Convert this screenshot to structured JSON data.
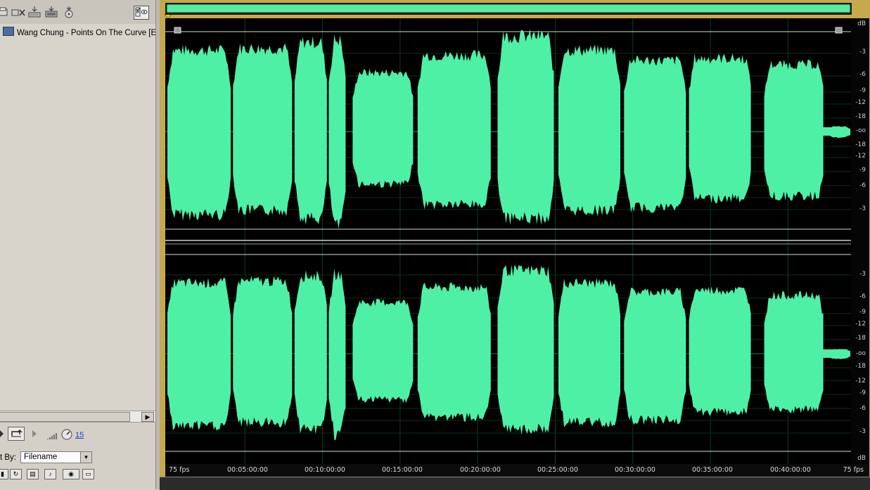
{
  "file_browser": {
    "files": [
      {
        "name": "Wang Chung - Points On The Curve [EU]."
      }
    ],
    "transport": {
      "volume_value": "15"
    },
    "sort": {
      "label": "t By:",
      "selected": "Filename"
    }
  },
  "editor": {
    "colors": {
      "waveform": "#4ef0a6",
      "background": "#000000",
      "frame": "#c7a94d"
    },
    "db_labels_top": [
      "dB",
      "-3",
      "-6",
      "-9",
      "-12",
      "-18",
      "-oo",
      "-18",
      "-12",
      "-9",
      "-6",
      "-3"
    ],
    "db_labels_bottom": [
      "-3",
      "-6",
      "-9",
      "-12",
      "-18",
      "-oo",
      "-18",
      "-12",
      "-9",
      "-6",
      "-3",
      "dB"
    ],
    "ruler": {
      "left_label": "75 fps",
      "right_label": "75 fps",
      "ticks": [
        "00:05:00:00",
        "00:10:00:00",
        "00:15:00:00",
        "00:20:00:00",
        "00:25:00:00",
        "00:30:00:00",
        "00:35:00:00",
        "00:40:00:00"
      ]
    }
  }
}
